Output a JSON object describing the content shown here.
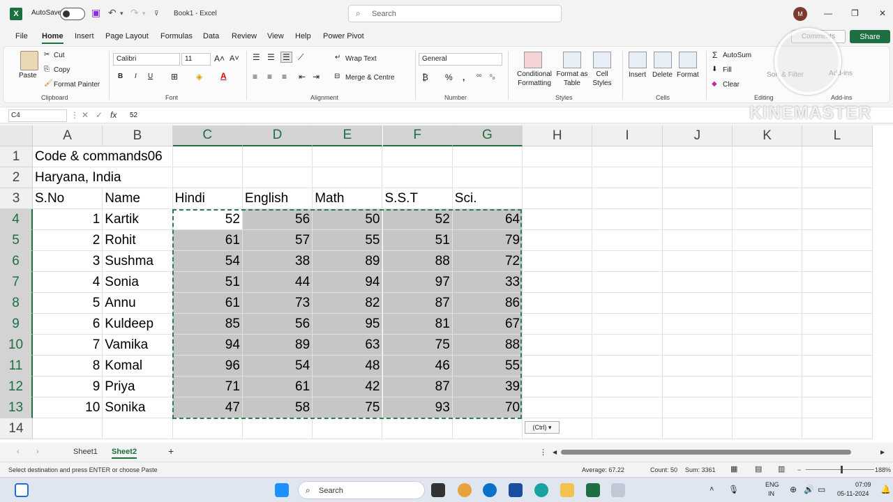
{
  "title_bar": {
    "app_icon": "X",
    "autosave_label": "AutoSave",
    "doc_title": "Book1 - Excel",
    "search_placeholder": "Search",
    "user_initial": "M",
    "minimize": "—",
    "restore": "❐",
    "close": "✕"
  },
  "menu": {
    "tabs": [
      "File",
      "Home",
      "Insert",
      "Page Layout",
      "Formulas",
      "Data",
      "Review",
      "View",
      "Help",
      "Power Pivot"
    ],
    "active": "Home",
    "share_label": "Share",
    "comments_label": "Comments"
  },
  "ribbon": {
    "clipboard": {
      "paste": "Paste",
      "cut": "Cut",
      "copy": "Copy",
      "format_painter": "Format Painter",
      "group": "Clipboard"
    },
    "font": {
      "name": "Calibri",
      "size": "11",
      "bold": "B",
      "italic": "I",
      "underline": "U",
      "group": "Font"
    },
    "alignment": {
      "wrap_text": "Wrap Text",
      "merge": "Merge & Centre",
      "group": "Alignment"
    },
    "number": {
      "format": "General",
      "percent": "%",
      "group": "Number"
    },
    "styles": {
      "conditional": "Conditional Formatting",
      "format_table": "Format as Table",
      "cell_styles": "Cell Styles",
      "group": "Styles"
    },
    "cells": {
      "insert": "Insert",
      "delete": "Delete",
      "format": "Format",
      "group": "Cells"
    },
    "editing": {
      "autosum": "AutoSum",
      "fill": "Fill",
      "clear": "Clear",
      "sort": "Sort & Filter",
      "group": "Editing"
    },
    "addins": {
      "label": "Add-ins",
      "group": "Add-ins"
    }
  },
  "formula_bar": {
    "name_box": "C4",
    "fx": "fx",
    "value": "52"
  },
  "sheet": {
    "columns": [
      "A",
      "B",
      "C",
      "D",
      "E",
      "F",
      "G",
      "H",
      "I",
      "J",
      "K",
      "L"
    ],
    "selected_columns": [
      "C",
      "D",
      "E",
      "F",
      "G"
    ],
    "rows": [
      "1",
      "2",
      "3",
      "4",
      "5",
      "6",
      "7",
      "8",
      "9",
      "10",
      "11",
      "12",
      "13",
      "14"
    ],
    "selected_rows": [
      "4",
      "5",
      "6",
      "7",
      "8",
      "9",
      "10",
      "11",
      "12",
      "13"
    ],
    "a1": "Code & commands06",
    "a2": "Haryana, India",
    "headers": [
      "S.No",
      "Name",
      "Hindi",
      "English",
      "Math",
      "S.S.T",
      "Sci."
    ],
    "data": [
      [
        "1",
        "Kartik",
        "52",
        "56",
        "50",
        "52",
        "64"
      ],
      [
        "2",
        "Rohit",
        "61",
        "57",
        "55",
        "51",
        "79"
      ],
      [
        "3",
        "Sushma",
        "54",
        "38",
        "89",
        "88",
        "72"
      ],
      [
        "4",
        "Sonia",
        "51",
        "44",
        "94",
        "97",
        "33"
      ],
      [
        "5",
        "Annu",
        "61",
        "73",
        "82",
        "87",
        "86"
      ],
      [
        "6",
        "Kuldeep",
        "85",
        "56",
        "95",
        "81",
        "67"
      ],
      [
        "7",
        "Vamika",
        "94",
        "89",
        "63",
        "75",
        "88"
      ],
      [
        "8",
        "Komal",
        "96",
        "54",
        "48",
        "46",
        "55"
      ],
      [
        "9",
        "Priya",
        "71",
        "61",
        "42",
        "87",
        "39"
      ],
      [
        "10",
        "Sonika",
        "47",
        "58",
        "75",
        "93",
        "70"
      ]
    ],
    "paste_options": "(Ctrl) ▾"
  },
  "sheet_tabs": {
    "tabs": [
      "Sheet1",
      "Sheet2"
    ],
    "active": "Sheet2",
    "add": "+"
  },
  "status_bar": {
    "message": "Select destination and press ENTER or choose Paste",
    "average": "Average: 67.22",
    "count": "Count: 50",
    "sum": "Sum: 3361",
    "zoom": "188%"
  },
  "watermark": "KINEMASTER",
  "taskbar": {
    "search": "Search",
    "lang": "ENG",
    "region": "IN",
    "time": "07:09",
    "date": "05-11-2024"
  },
  "colors": {
    "excel_green": "#1d6f42",
    "selection_fill": "#c6c6c6"
  }
}
